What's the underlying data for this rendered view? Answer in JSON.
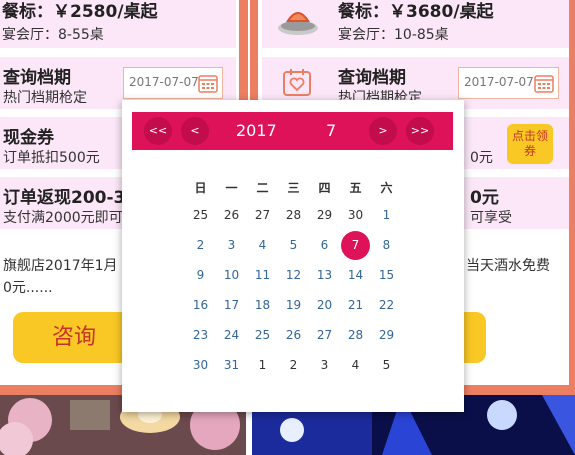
{
  "left": {
    "card1": {
      "title": "餐标：￥2580/桌起",
      "sub": "宴会厅：8-55桌"
    },
    "card2": {
      "title": "查询档期",
      "sub": "热门档期枪定",
      "date": "2017-07-07"
    },
    "card3": {
      "title": "现金券",
      "sub": "订单抵扣500元"
    },
    "card4": {
      "title": "订单返现200-3",
      "sub": "支付满2000元即可"
    },
    "desc1": "旗舰店2017年1月",
    "desc2": "0元......",
    "consult": "咨询"
  },
  "right": {
    "card1": {
      "title": "餐标：￥3680/桌起",
      "sub": "宴会厅：10-85桌"
    },
    "card2": {
      "title": "查询档期",
      "sub": "热门档期枪定",
      "date": "2017-07-07"
    },
    "card3": {
      "sub": "0元"
    },
    "card4": {
      "title": "0元",
      "sub": "可享受"
    },
    "coupon_btn": "点击领券",
    "desc1": "当天酒水免费"
  },
  "picker": {
    "prev_year": "<<",
    "prev_month": "<",
    "year": "2017",
    "month": "7",
    "next_month": ">",
    "next_year": ">>",
    "weekdays": [
      "日",
      "一",
      "二",
      "三",
      "四",
      "五",
      "六"
    ],
    "weeks": [
      [
        "25",
        "26",
        "27",
        "28",
        "29",
        "30",
        "1"
      ],
      [
        "2",
        "3",
        "4",
        "5",
        "6",
        "7",
        "8"
      ],
      [
        "9",
        "10",
        "11",
        "12",
        "13",
        "14",
        "15"
      ],
      [
        "16",
        "17",
        "18",
        "19",
        "20",
        "21",
        "22"
      ],
      [
        "23",
        "24",
        "25",
        "26",
        "27",
        "28",
        "29"
      ],
      [
        "30",
        "31",
        "1",
        "2",
        "3",
        "4",
        "5"
      ]
    ],
    "selected": "7",
    "accent": "#dd1259"
  },
  "colors": {
    "border": "#ec7f62",
    "card_bg": "#fbe7f7",
    "button": "#f9c825"
  }
}
